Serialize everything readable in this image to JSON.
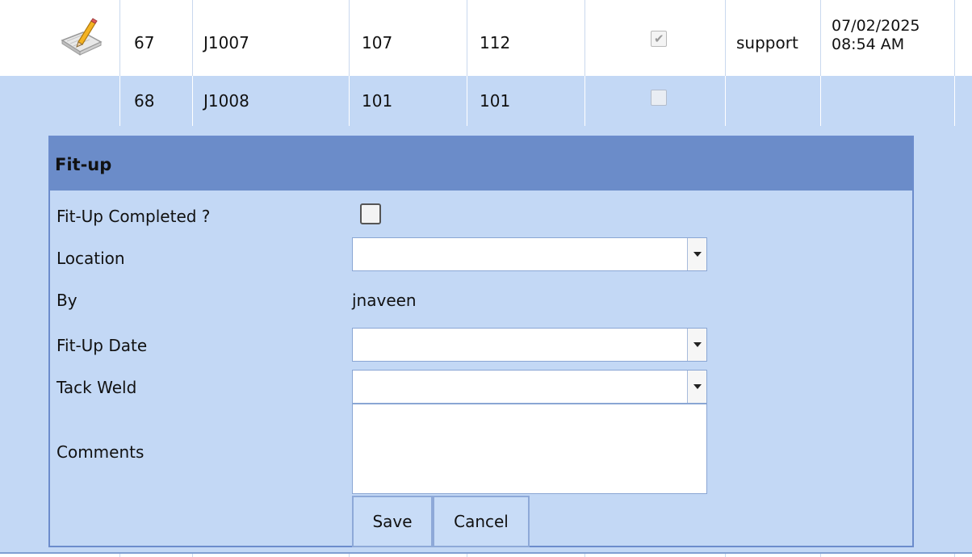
{
  "rows": [
    {
      "number": "67",
      "joint": "J1007",
      "col_a": "107",
      "col_b": "112",
      "checked": true,
      "user": "support",
      "date": "07/02/2025",
      "time": "08:54 AM"
    },
    {
      "number": "68",
      "joint": "J1008",
      "col_a": "101",
      "col_b": "101",
      "checked": false,
      "user": "",
      "date": "",
      "time": ""
    }
  ],
  "form": {
    "title": "Fit-up",
    "fitup_completed_label": "Fit-Up Completed ?",
    "fitup_completed_value": false,
    "location_label": "Location",
    "location_value": "",
    "by_label": "By",
    "by_value": "jnaveen",
    "fitup_date_label": "Fit-Up Date",
    "fitup_date_value": "",
    "tack_weld_label": "Tack Weld",
    "tack_weld_value": "",
    "comments_label": "Comments",
    "comments_value": "",
    "save_label": "Save",
    "cancel_label": "Cancel"
  },
  "icons": {
    "edit": "edit-pencil-icon",
    "check": "checkmark-icon",
    "dropdown": "chevron-down-icon"
  },
  "colors": {
    "selected_row": "#c3d8f5",
    "panel_header": "#6b8cc9",
    "panel_border": "#6c8ccc",
    "grid_line": "#c9d8ee"
  }
}
